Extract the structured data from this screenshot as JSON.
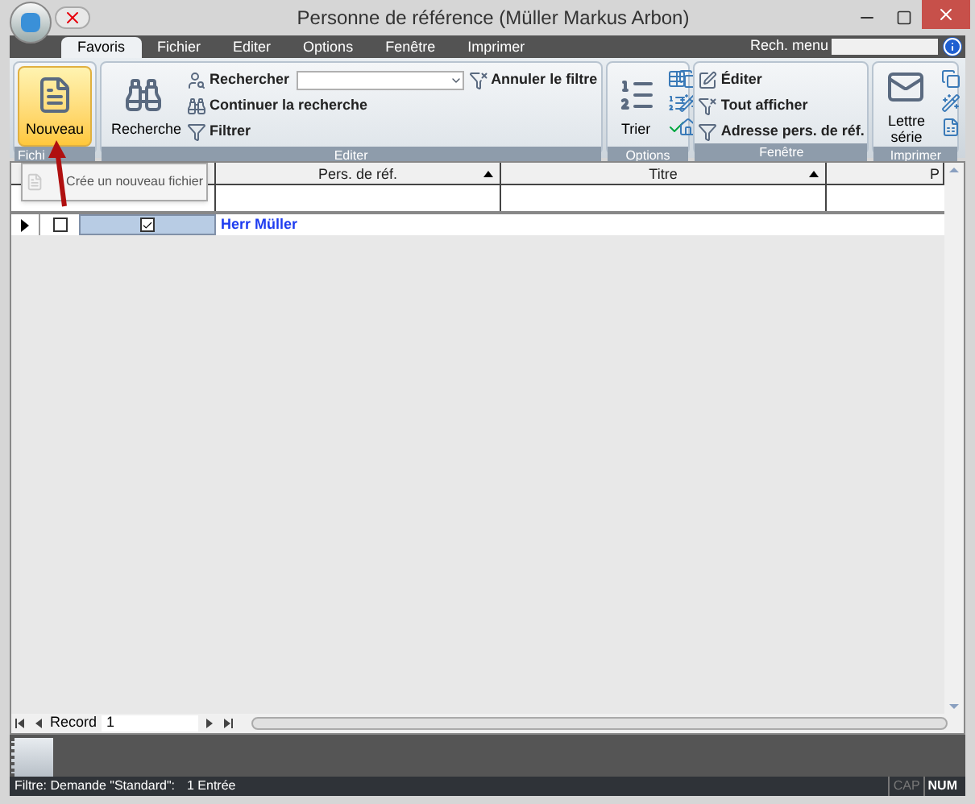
{
  "window": {
    "title": "Personne de référence (Müller Markus Arbon)"
  },
  "tabs": [
    {
      "label": "Favoris",
      "selected": true
    },
    {
      "label": "Fichier",
      "selected": false
    },
    {
      "label": "Editer",
      "selected": false
    },
    {
      "label": "Options",
      "selected": false
    },
    {
      "label": "Fenêtre",
      "selected": false
    },
    {
      "label": "Imprimer",
      "selected": false
    }
  ],
  "menu_search": {
    "label": "Rech. menu"
  },
  "ribbon": {
    "groups": [
      {
        "label": "Fichi",
        "large": [
          {
            "label": "Nouveau",
            "selected": true
          }
        ]
      },
      {
        "label": "Editer",
        "large": [
          {
            "label": "Recherche",
            "selected": false
          }
        ],
        "small": [
          {
            "label": "Rechercher",
            "kind": "combo"
          },
          {
            "label": "Continuer la recherche",
            "kind": "button"
          },
          {
            "label": "Filtrer",
            "kind": "button"
          },
          {
            "label": "Annuler le filtre",
            "kind": "button"
          }
        ]
      },
      {
        "label": "Options",
        "large": [
          {
            "label": "Trier",
            "selected": false
          }
        ],
        "small": [
          {
            "kind": "icons"
          }
        ]
      },
      {
        "label": "Fenêtre",
        "small": [
          {
            "label": "Éditer",
            "kind": "button"
          },
          {
            "label": "Tout afficher",
            "kind": "button"
          },
          {
            "label": "Adresse pers. de réf.",
            "kind": "button"
          }
        ]
      },
      {
        "label": "Imprimer",
        "large": [
          {
            "label": "Lettre série",
            "selected": false
          }
        ],
        "small": [
          {
            "kind": "icons"
          }
        ]
      }
    ]
  },
  "tooltip": {
    "text": "Crée un nouveau fichier"
  },
  "table": {
    "columns": [
      "Pers. de réf.",
      "Titre",
      "P"
    ],
    "rows": [
      {
        "current": true,
        "marked": false,
        "checked": true,
        "cells": [
          "Herr Müller"
        ]
      }
    ]
  },
  "navigation": {
    "label": "Record",
    "value": "1"
  },
  "status_bar": {
    "filter": "Filtre: Demande \"Standard\":",
    "count": "1 Entrée",
    "cap": {
      "label": "CAP",
      "on": false
    },
    "num": {
      "label": "NUM",
      "on": true
    }
  }
}
